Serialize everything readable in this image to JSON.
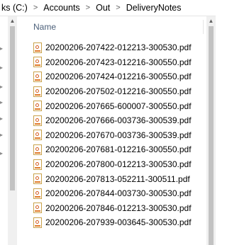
{
  "address": {
    "crumbs": [
      "ks (C:)",
      "Accounts",
      "Out",
      "DeliveryNotes"
    ],
    "separator": ">"
  },
  "list": {
    "column_name": "Name",
    "files": [
      "20200206-207422-012213-300530.pdf",
      "20200206-207423-012216-300550.pdf",
      "20200206-207424-012216-300550.pdf",
      "20200206-207502-012216-300550.pdf",
      "20200206-207665-600007-300550.pdf",
      "20200206-207666-003736-300539.pdf",
      "20200206-207670-003736-300539.pdf",
      "20200206-207681-012216-300550.pdf",
      "20200206-207800-012213-300530.pdf",
      "20200206-207813-052211-300511.pdf",
      "20200206-207844-003730-300530.pdf",
      "20200206-207846-012213-300530.pdf",
      "20200206-207939-003645-300530.pdf"
    ]
  },
  "icons": {
    "file": "pdf-file-icon",
    "scroll_up": "chevron-up-icon",
    "nav_expand": "chevron-right-icon"
  }
}
